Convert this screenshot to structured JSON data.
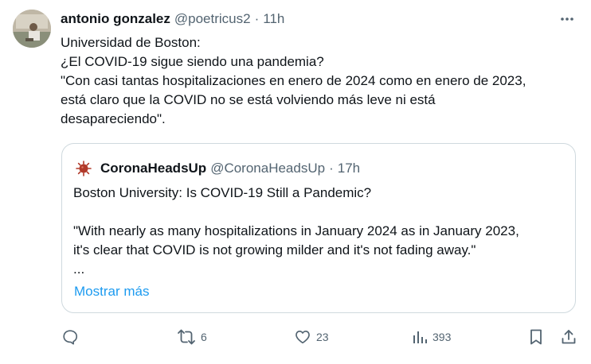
{
  "tweet": {
    "author_name": "antonio gonzalez",
    "author_handle": "@poetricus2",
    "separator": "·",
    "time": "11h",
    "text_lines": [
      "Universidad de Boston:",
      "¿El COVID-19 sigue siendo una pandemia?",
      "\"Con casi tantas hospitalizaciones en enero de 2024 como en enero de 2023,",
      "está claro que la COVID no se está volviendo más leve ni está",
      "desapareciendo\"."
    ]
  },
  "quote": {
    "author_name": "CoronaHeadsUp",
    "author_handle": "@CoronaHeadsUp",
    "separator": "·",
    "time": "17h",
    "text_lines": [
      "Boston University: Is COVID-19 Still a Pandemic?",
      "",
      "\"With nearly as many hospitalizations in January 2024 as in January 2023,",
      "it's clear that COVID is not growing milder and it's not fading away.\"",
      "..."
    ],
    "show_more": "Mostrar más"
  },
  "actions": {
    "replies": "",
    "retweets": "6",
    "likes": "23",
    "views": "393"
  },
  "colors": {
    "text": "#0f1419",
    "secondary": "#536471",
    "link": "#1d9bf0",
    "border": "#cfd9de",
    "virus_icon": "#b13a2a"
  },
  "icons": {
    "more": "more-dots-icon",
    "reply": "reply-icon",
    "retweet": "retweet-icon",
    "like": "heart-icon",
    "views": "views-chart-icon",
    "bookmark": "bookmark-icon",
    "share": "share-icon",
    "quote_avatar": "virus-icon"
  }
}
